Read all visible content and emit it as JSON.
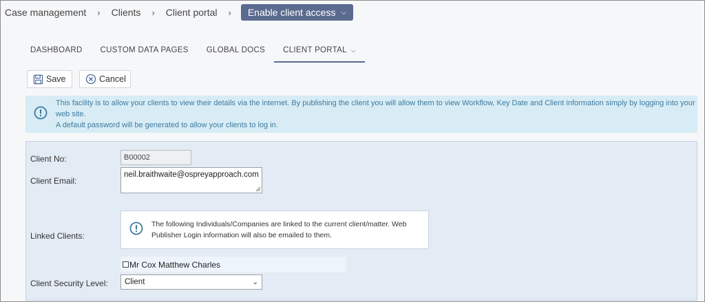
{
  "breadcrumb": {
    "items": [
      "Case management",
      "Clients",
      "Client portal"
    ],
    "current": "Enable client access"
  },
  "tabs": [
    {
      "label": "DASHBOARD"
    },
    {
      "label": "CUSTOM DATA PAGES"
    },
    {
      "label": "GLOBAL DOCS"
    },
    {
      "label": "CLIENT PORTAL",
      "active": true
    }
  ],
  "toolbar": {
    "save_label": "Save",
    "cancel_label": "Cancel"
  },
  "info_banner": {
    "line1": "This facility is to allow your clients to view their details via the internet. By publishing the client you will allow them to view Workflow, Key Date and Client information simply by logging into your web site.",
    "line2": "A default password will be generated to allow your clients to log in."
  },
  "form": {
    "client_no_label": "Client No:",
    "client_no_value": "B00002",
    "client_email_label": "Client Email:",
    "client_email_value": "neil.braithwaite@ospreyapproach.com",
    "linked_clients_label": "Linked Clients:",
    "linked_info_line1": "The following Individuals/Companies are linked to the current client/matter. Web",
    "linked_info_line2": "Publisher Login information will also be emailed to them.",
    "linked_client_name": "Mr Cox Matthew Charles",
    "security_level_label": "Client Security Level:",
    "security_level_value": "Client"
  },
  "colors": {
    "accent": "#5b6a8f",
    "info_bg": "#d7ecf5",
    "info_text": "#3e7aa0",
    "panel_bg": "#e3ebf4"
  }
}
